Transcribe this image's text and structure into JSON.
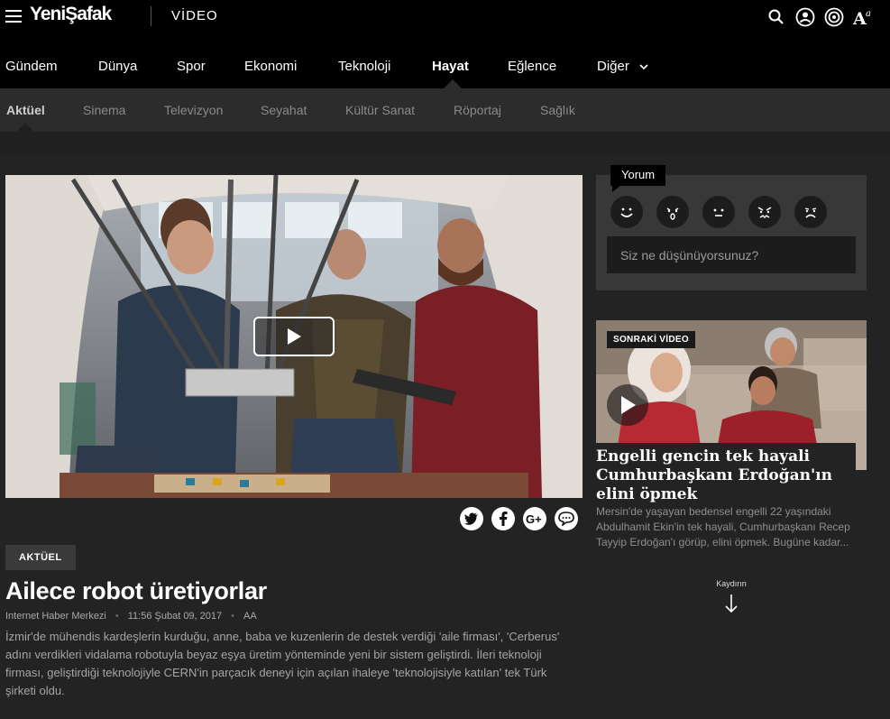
{
  "brand": {
    "logo": "YeniŞafak",
    "section": "VİDEO"
  },
  "main_nav": [
    {
      "label": "Gündem",
      "active": false
    },
    {
      "label": "Dünya",
      "active": false
    },
    {
      "label": "Spor",
      "active": false
    },
    {
      "label": "Ekonomi",
      "active": false
    },
    {
      "label": "Teknoloji",
      "active": false
    },
    {
      "label": "Hayat",
      "active": true
    },
    {
      "label": "Eğlence",
      "active": false
    },
    {
      "label": "Diğer",
      "active": false
    }
  ],
  "sub_nav": [
    {
      "label": "Aktüel",
      "active": true
    },
    {
      "label": "Sinema",
      "active": false
    },
    {
      "label": "Televizyon",
      "active": false
    },
    {
      "label": "Seyahat",
      "active": false
    },
    {
      "label": "Kültür Sanat",
      "active": false
    },
    {
      "label": "Röportaj",
      "active": false
    },
    {
      "label": "Sağlık",
      "active": false
    }
  ],
  "top_icons": [
    "search-icon",
    "user-icon",
    "target-icon",
    "font-size-icon"
  ],
  "article": {
    "category": "AKTÜEL",
    "title": "Ailece robot üretiyorlar",
    "author": "Internet Haber Merkezi",
    "datetime": "11:56 Şubat 09, 2017",
    "font_control": "AA",
    "description": "İzmir'de mühendis kardeşlerin kurduğu, anne, baba ve kuzenlerin de destek verdiği 'aile firması', 'Cerberus' adını verdikleri vidalama robotuyla beyaz eşya üretim yönteminde yeni bir sistem geliştirdi. İleri teknoloji firması, geliştirdiği teknolojiyle CERN'in parçacık deneyi için açılan ihaleye 'teknolojisiyle katılan' tek Türk şirketi oldu."
  },
  "share": [
    "twitter-icon",
    "facebook-icon",
    "google-plus-icon",
    "comment-icon"
  ],
  "comment": {
    "tab_label": "Yorum",
    "placeholder": "Siz ne düşünüyorsunuz?",
    "reactions": [
      "smile",
      "surprised",
      "neutral",
      "angry",
      "sad"
    ]
  },
  "next_video": {
    "label": "SONRAKİ VİDEO",
    "title": "Engelli gencin tek hayali Cumhurbaşkanı Erdoğan'ın elini öpmek",
    "description": "Mersin'de yaşayan bedensel engelli 22 yaşındaki Abdulhamit Ekin'in tek hayali, Cumhurbaşkanı Recep Tayyip Erdoğan'ı görüp, elini öpmek. Bugüne kadar..."
  },
  "scroll_hint": "Kaydırın",
  "colors": {
    "background": "#000000",
    "content_bg": "#232323",
    "subnav_bg": "#2c2c2c"
  }
}
